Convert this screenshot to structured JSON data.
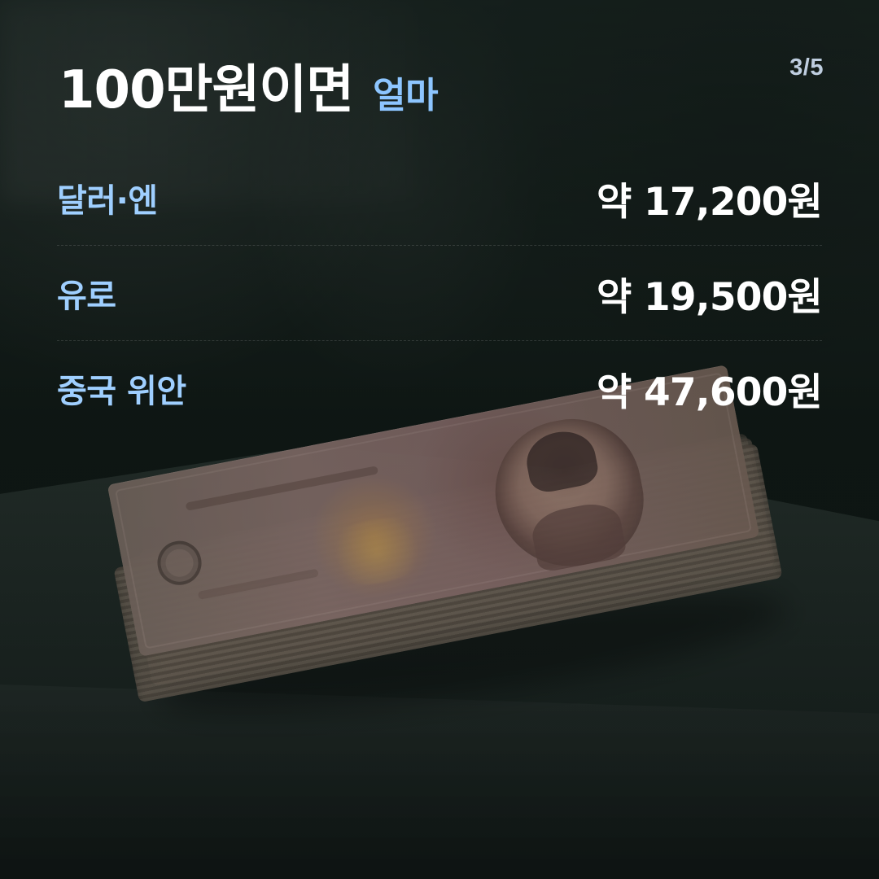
{
  "meta": {
    "page_indicator": "3/5"
  },
  "headline": {
    "main": "100만원이면",
    "accent": "얼마"
  },
  "rates": [
    {
      "label": "달러·엔",
      "value": "약 17,200원"
    },
    {
      "label": "유로",
      "value": "약 19,500원"
    },
    {
      "label": "중국 위안",
      "value": "약 47,600원"
    }
  ],
  "colors": {
    "accent": "#8dc5ff",
    "text": "#ffffff",
    "background_dark": "#0f1714"
  },
  "icons": {
    "background_image": "cash-stack-image"
  }
}
